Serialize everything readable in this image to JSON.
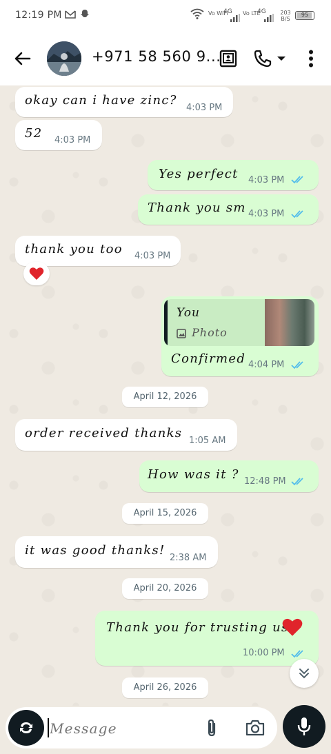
{
  "status_bar": {
    "time": "12:19 PM",
    "net_1": "Vo WiFi",
    "net_2": "Vo LTE",
    "data_4g_1": "4G",
    "data_4g_2": "4G",
    "speed": "203 B/S",
    "battery": "95"
  },
  "header": {
    "contact_title": "+971 58 560 9..."
  },
  "messages": [
    {
      "text": "okay can i have zinc?",
      "time": "4:03 PM",
      "dir": "in"
    },
    {
      "text": "52",
      "time": "4:03 PM",
      "dir": "in"
    },
    {
      "text": "Yes perfect",
      "time": "4:03 PM",
      "dir": "out"
    },
    {
      "text": "Thank you sm",
      "time": "4:03 PM",
      "dir": "out"
    },
    {
      "text": "thank you too",
      "time": "4:03 PM",
      "dir": "in",
      "reaction": "❤️"
    },
    {
      "reply_sender": "You",
      "reply_kind": "Photo",
      "text": "Confirmed",
      "time": "4:04 PM",
      "dir": "out"
    },
    {
      "text": "order received thanks",
      "time": "1:05 AM",
      "dir": "in"
    },
    {
      "text": "How was it ?",
      "time": "12:48 PM",
      "dir": "out"
    },
    {
      "text": "it was good thanks!",
      "time": "2:38 AM",
      "dir": "in"
    },
    {
      "text": "Thank you for trusting us",
      "time": "10:00 PM",
      "dir": "out"
    }
  ],
  "dates": [
    "April 12, 2026",
    "April 15, 2026",
    "April 20, 2026",
    "April 26, 2026"
  ],
  "composer": {
    "placeholder": "Message"
  },
  "colors": {
    "chat_bg": "#efeae2",
    "outgoing_bubble": "#d9fdd3",
    "incoming_bubble": "#ffffff",
    "read_tick": "#53bdeb",
    "reply_bar": "#111b21"
  },
  "icons": [
    "back-arrow-icon",
    "contact-card-icon",
    "phone-icon",
    "dropdown-icon",
    "more-vert-icon",
    "image-icon",
    "read-tick-icon",
    "heart-icon",
    "scroll-down-icon",
    "sticker-icon",
    "attach-icon",
    "camera-icon",
    "mic-icon"
  ]
}
